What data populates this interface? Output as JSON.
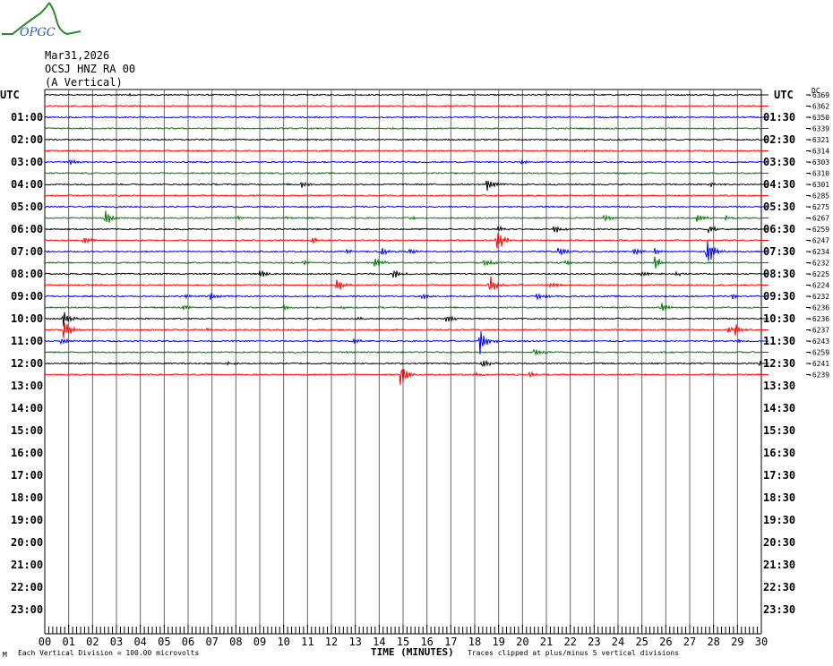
{
  "logo_text": "OPGC",
  "header": {
    "date": "Mar31,2026",
    "station": "OCSJ HNZ RA 00",
    "component": "(A Vertical)"
  },
  "colors": {
    "trace_cycle": [
      "#000000",
      "#ff0000",
      "#0000ff",
      "#007700"
    ],
    "logo_green": "#2a8a2a",
    "logo_blue": "#2255cc"
  },
  "chart_data": {
    "type": "line",
    "title": "OCSJ HNZ RA 00 (A Vertical) Mar31,2026",
    "xlabel": "TIME (MINUTES)",
    "ylabel": "UTC",
    "xlim": [
      0,
      30
    ],
    "x_ticks": [
      "00",
      "01",
      "02",
      "03",
      "04",
      "05",
      "06",
      "07",
      "08",
      "09",
      "10",
      "11",
      "12",
      "13",
      "14",
      "15",
      "16",
      "17",
      "18",
      "19",
      "20",
      "21",
      "22",
      "23",
      "24",
      "25",
      "26",
      "27",
      "28",
      "29",
      "30"
    ],
    "left_axis_label": "UTC",
    "right_axis_label": "UTC",
    "dc_label": "DC",
    "left_times": [
      "01:00",
      "02:00",
      "03:00",
      "04:00",
      "05:00",
      "06:00",
      "07:00",
      "08:00",
      "09:00",
      "10:00",
      "11:00",
      "12:00",
      "13:00",
      "14:00",
      "15:00",
      "16:00",
      "17:00",
      "18:00",
      "19:00",
      "20:00",
      "21:00",
      "22:00",
      "23:00"
    ],
    "right_times": [
      "01:30",
      "02:30",
      "03:30",
      "04:30",
      "05:30",
      "06:30",
      "07:30",
      "08:30",
      "09:30",
      "10:30",
      "11:30",
      "12:30",
      "13:30",
      "14:30",
      "15:30",
      "16:30",
      "17:30",
      "18:30",
      "19:30",
      "20:30",
      "21:30",
      "22:30",
      "23:30"
    ],
    "dc_offsets": [
      "-6369",
      "-6362",
      "-6350",
      "-6339",
      "-6321",
      "-6314",
      "-6303",
      "-6310",
      "-6301",
      "-6285",
      "-6275",
      "-6267",
      "-6259",
      "-6247",
      "-6234",
      "-6232",
      "-6225",
      "-6224",
      "-6232",
      "-6236",
      "-6236",
      "-6237",
      "-6243",
      "-6259",
      "-6241",
      "-6239"
    ],
    "trace_rows": 26,
    "last_trace_end_minute": 30,
    "events": [
      [
        0,
        3.5,
        1.5
      ],
      [
        6,
        1.0,
        3
      ],
      [
        6,
        19.9,
        3
      ],
      [
        8,
        10.7,
        4
      ],
      [
        8,
        18.5,
        8
      ],
      [
        8,
        27.8,
        3
      ],
      [
        11,
        2.5,
        10
      ],
      [
        11,
        8.1,
        2
      ],
      [
        11,
        10.1,
        2
      ],
      [
        11,
        15.3,
        2
      ],
      [
        11,
        23.4,
        4
      ],
      [
        11,
        27.3,
        6
      ],
      [
        11,
        28.5,
        3
      ],
      [
        12,
        19.0,
        3
      ],
      [
        12,
        21.3,
        5
      ],
      [
        12,
        27.8,
        6
      ],
      [
        13,
        1.6,
        4
      ],
      [
        13,
        11.2,
        4
      ],
      [
        13,
        18.9,
        14
      ],
      [
        14,
        12.6,
        4
      ],
      [
        14,
        14.1,
        5
      ],
      [
        14,
        15.2,
        4
      ],
      [
        14,
        21.5,
        6
      ],
      [
        14,
        24.6,
        5
      ],
      [
        14,
        25.5,
        4
      ],
      [
        14,
        27.7,
        16
      ],
      [
        15,
        10.8,
        3
      ],
      [
        15,
        13.8,
        6
      ],
      [
        15,
        18.4,
        6
      ],
      [
        15,
        25.5,
        8
      ],
      [
        15,
        21.8,
        3
      ],
      [
        16,
        9.0,
        6
      ],
      [
        16,
        14.6,
        6
      ],
      [
        16,
        25.0,
        3
      ],
      [
        16,
        26.4,
        3
      ],
      [
        17,
        12.2,
        8
      ],
      [
        17,
        18.6,
        12
      ],
      [
        17,
        21.1,
        4
      ],
      [
        17,
        2.0,
        2
      ],
      [
        18,
        6.9,
        5
      ],
      [
        18,
        15.8,
        4
      ],
      [
        18,
        20.6,
        4
      ],
      [
        18,
        28.8,
        3
      ],
      [
        18,
        5.9,
        2
      ],
      [
        19,
        5.8,
        3
      ],
      [
        19,
        10.0,
        3
      ],
      [
        19,
        12.4,
        2
      ],
      [
        19,
        25.8,
        5
      ],
      [
        20,
        0.75,
        9
      ],
      [
        20,
        13.1,
        2
      ],
      [
        20,
        16.8,
        6
      ],
      [
        21,
        0.8,
        12
      ],
      [
        21,
        6.8,
        2
      ],
      [
        21,
        28.6,
        5
      ],
      [
        21,
        28.9,
        5
      ],
      [
        22,
        0.7,
        4
      ],
      [
        22,
        12.9,
        3
      ],
      [
        22,
        18.2,
        14
      ],
      [
        22,
        29.0,
        2
      ],
      [
        23,
        20.5,
        5
      ],
      [
        23,
        12.6,
        2
      ],
      [
        24,
        7.6,
        2
      ],
      [
        24,
        18.3,
        5
      ],
      [
        24,
        29.9,
        5
      ],
      [
        25,
        14.9,
        14
      ],
      [
        25,
        20.3,
        3
      ],
      [
        25,
        18.0,
        3
      ]
    ]
  },
  "footer": {
    "left_mark": "M",
    "division_note": "Each Vertical Division =  100.00 microvolts",
    "clip_note": "Traces clipped at plus/minus 5 vertical divisions"
  }
}
